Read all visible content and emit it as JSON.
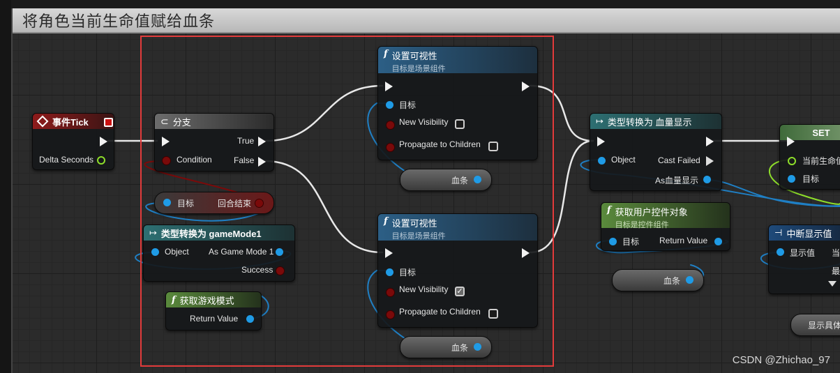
{
  "graph_title": "将角色当前生命值赋给血条",
  "nodes": {
    "event_tick": {
      "title": "事件Tick",
      "pin_delta": "Delta Seconds"
    },
    "branch": {
      "title": "分支",
      "pin_condition": "Condition",
      "pin_true": "True",
      "pin_false": "False"
    },
    "set_vis_1": {
      "title": "设置可视性",
      "subtitle": "目标是场景组件",
      "pin_target": "目标",
      "pin_new_vis": "New Visibility",
      "pin_propagate": "Propagate to Children",
      "new_vis_checked": false,
      "propagate_checked": false
    },
    "set_vis_2": {
      "title": "设置可视性",
      "subtitle": "目标是场景组件",
      "pin_target": "目标",
      "pin_new_vis": "New Visibility",
      "pin_propagate": "Propagate to Children",
      "new_vis_checked": true,
      "propagate_checked": false
    },
    "target_round_end": {
      "pin_target": "目标",
      "pin_out": "回合结束"
    },
    "cast_gamemode": {
      "title": "类型转换为 gameMode1",
      "pin_object": "Object",
      "pin_as": "As Game Mode 1",
      "pin_success": "Success"
    },
    "get_game_mode": {
      "title": "获取游戏模式",
      "pin_return": "Return Value"
    },
    "health_var_1": {
      "label": "血条"
    },
    "health_var_2": {
      "label": "血条"
    },
    "cast_health": {
      "title": "类型转换为 血量显示",
      "pin_object": "Object",
      "pin_cast_failed": "Cast Failed",
      "pin_as": "As血量显示"
    },
    "get_user_widget": {
      "title": "获取用户控件对象",
      "subtitle": "目标是控件组件",
      "pin_target": "目标",
      "pin_return": "Return Value"
    },
    "health_var_3": {
      "label": "血条"
    },
    "set_node": {
      "title": "SET",
      "pin_current_hp": "当前生命值",
      "pin_target": "目标"
    },
    "breakpoint_display": {
      "title": "中断显示值",
      "pin_display": "显示值",
      "pin_cut1": "当",
      "pin_cut2": "最"
    },
    "display_detail": {
      "label": "显示具体"
    }
  },
  "watermark": "CSDN @Zhichao_97",
  "colors": {
    "exec": "#f2f2f2",
    "object_pin": "#1f9be6",
    "bool_pin": "#7a0a0a",
    "float_pin": "#8ede2a",
    "selection": "#e23b3b"
  }
}
